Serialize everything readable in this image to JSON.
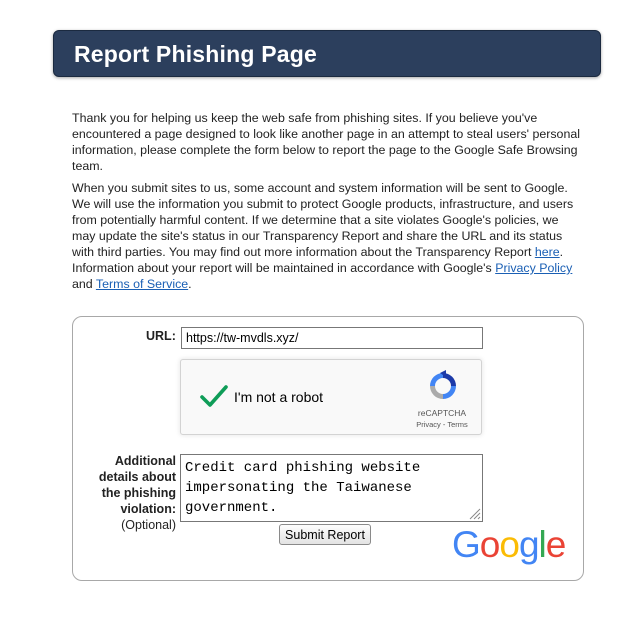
{
  "header": {
    "title": "Report Phishing Page"
  },
  "intro": {
    "p1": "Thank you for helping us keep the web safe from phishing sites. If you believe you've encountered a page designed to look like another page in an attempt to steal users' personal information, please complete the form below to report the page to the Google Safe Browsing team.",
    "p2_before_here": "When you submit sites to us, some account and system information will be sent to Google. We will use the information you submit to protect Google products, infrastructure, and users from potentially harmful content. If we determine that a site violates Google's policies, we may update the site's status in our Transparency Report and share the URL and its status with third parties. You may find out more information about the Transparency Report ",
    "here_link": "here",
    "p2_after_here": ". Information about your report will be maintained in accordance with Google's ",
    "privacy_link": "Privacy Policy",
    "and_text": " and ",
    "terms_link": "Terms of Service",
    "end_period": "."
  },
  "form": {
    "url_label": "URL:",
    "url_value": "https://tw-mvdls.xyz/",
    "captcha": {
      "label": "I'm not a robot",
      "brand": "reCAPTCHA",
      "links": "Privacy - Terms"
    },
    "details_label_bold": "Additional details about the phishing violation:",
    "details_label_optional": "(Optional)",
    "details_value": "Credit card phishing website impersonating the Taiwanese government.",
    "submit_label": "Submit Report"
  },
  "logo": {
    "letters": [
      "G",
      "o",
      "o",
      "g",
      "l",
      "e"
    ],
    "colors": [
      "#4285f4",
      "#ea4335",
      "#fbbc05",
      "#4285f4",
      "#34a853",
      "#ea4335"
    ]
  },
  "colors": {
    "header_bg": "#2c3f5d",
    "link": "#1a5fb4",
    "check": "#0f9d58"
  }
}
